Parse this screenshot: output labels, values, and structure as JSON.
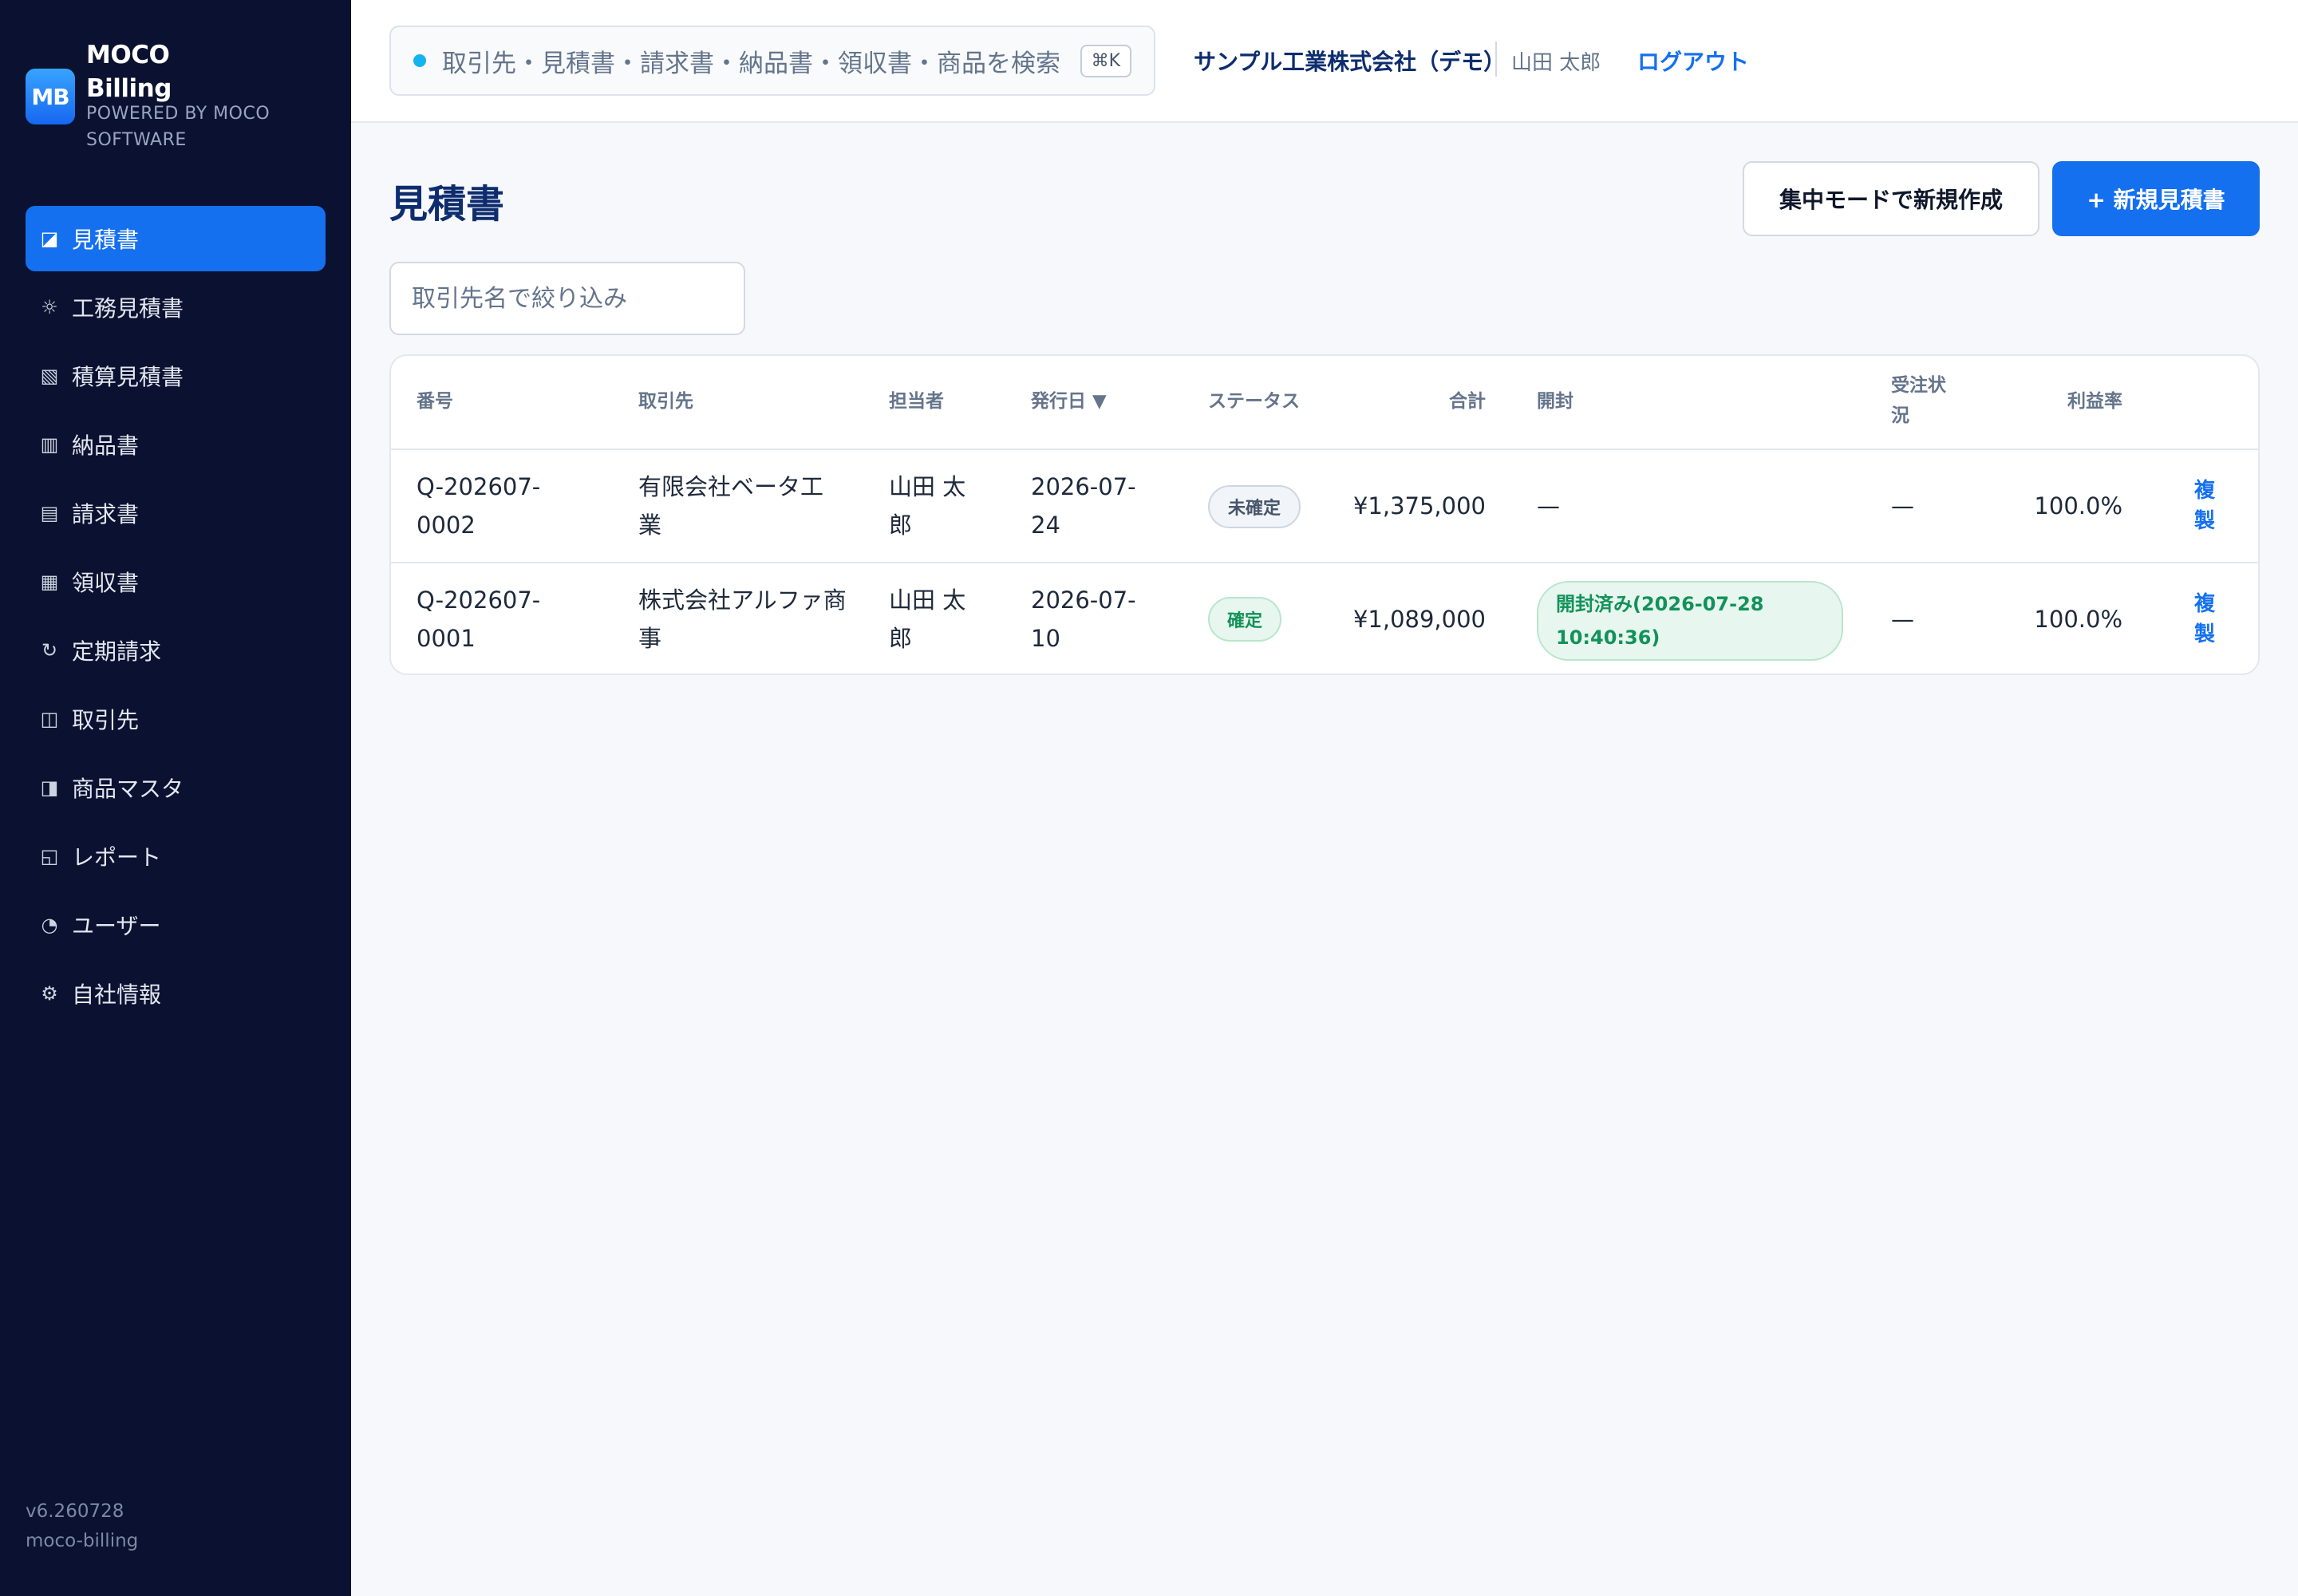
{
  "brand": {
    "logo_text": "MB",
    "name_line1": "MOCO",
    "name_line2": "Billing",
    "sub_line1": "POWERED BY MOCO",
    "sub_line2": "SOFTWARE"
  },
  "sidebar": {
    "items": [
      {
        "label": "見積書",
        "icon": "◪",
        "icon_name": "quote-icon",
        "active": true
      },
      {
        "label": "工務見積書",
        "icon": "☼",
        "icon_name": "construction-icon",
        "active": false
      },
      {
        "label": "積算見積書",
        "icon": "▧",
        "icon_name": "estimate-icon",
        "active": false
      },
      {
        "label": "納品書",
        "icon": "▥",
        "icon_name": "delivery-icon",
        "active": false
      },
      {
        "label": "請求書",
        "icon": "▤",
        "icon_name": "invoice-icon",
        "active": false
      },
      {
        "label": "領収書",
        "icon": "▦",
        "icon_name": "receipt-icon",
        "active": false
      },
      {
        "label": "定期請求",
        "icon": "↻",
        "icon_name": "recurring-icon",
        "active": false
      },
      {
        "label": "取引先",
        "icon": "◫",
        "icon_name": "clients-icon",
        "active": false
      },
      {
        "label": "商品マスタ",
        "icon": "◨",
        "icon_name": "products-icon",
        "active": false
      },
      {
        "label": "レポート",
        "icon": "◱",
        "icon_name": "report-icon",
        "active": false
      },
      {
        "label": "ユーザー",
        "icon": "◔",
        "icon_name": "users-icon",
        "active": false
      },
      {
        "label": "自社情報",
        "icon": "⚙",
        "icon_name": "gear-icon",
        "active": false
      }
    ],
    "version": "v6.260728",
    "app_id": "moco-billing"
  },
  "topbar": {
    "search_placeholder": "取引先・見積書・請求書・納品書・領収書・商品を検索",
    "shortcut": "⌘K",
    "company": "サンプル工業株式会社（デモ）",
    "user": "山田 太郎",
    "logout": "ログアウト"
  },
  "main": {
    "title": "見積書",
    "focus_button": "集中モードで新規作成",
    "new_button": "+ 新規見積書",
    "filter_placeholder": "取引先名で絞り込み",
    "columns": {
      "number": "番号",
      "client": "取引先",
      "owner": "担当者",
      "issue_date": "発行日 ▼",
      "status": "ステータス",
      "total": "合計",
      "opened": "開封",
      "order_l1": "受注状",
      "order_l2": "況",
      "margin": "利益率"
    },
    "rows": [
      {
        "number_l1": "Q-202607-",
        "number_l2": "0002",
        "client_l1": "有限会社ベータ工",
        "client_l2": "業",
        "owner_l1": "山田 太",
        "owner_l2": "郎",
        "date_l1": "2026-07-",
        "date_l2": "24",
        "status": "未確定",
        "total": "¥1,375,000",
        "opened": "—",
        "order": "—",
        "margin": "100.0%",
        "copy_l1": "複",
        "copy_l2": "製"
      },
      {
        "number_l1": "Q-202607-",
        "number_l2": "0001",
        "client_l1": "株式会社アルファ商",
        "client_l2": "事",
        "owner_l1": "山田 太",
        "owner_l2": "郎",
        "date_l1": "2026-07-",
        "date_l2": "10",
        "status": "確定",
        "total": "¥1,089,000",
        "opened_l1": "開封済み(2026-07-28",
        "opened_l2": "10:40:36)",
        "order": "—",
        "margin": "100.0%",
        "copy_l1": "複",
        "copy_l2": "製"
      }
    ]
  },
  "colors": {
    "sidebar_bg": "#0b1130",
    "accent": "#1570ef",
    "title": "#0e2d6e",
    "success": "#12925a"
  }
}
